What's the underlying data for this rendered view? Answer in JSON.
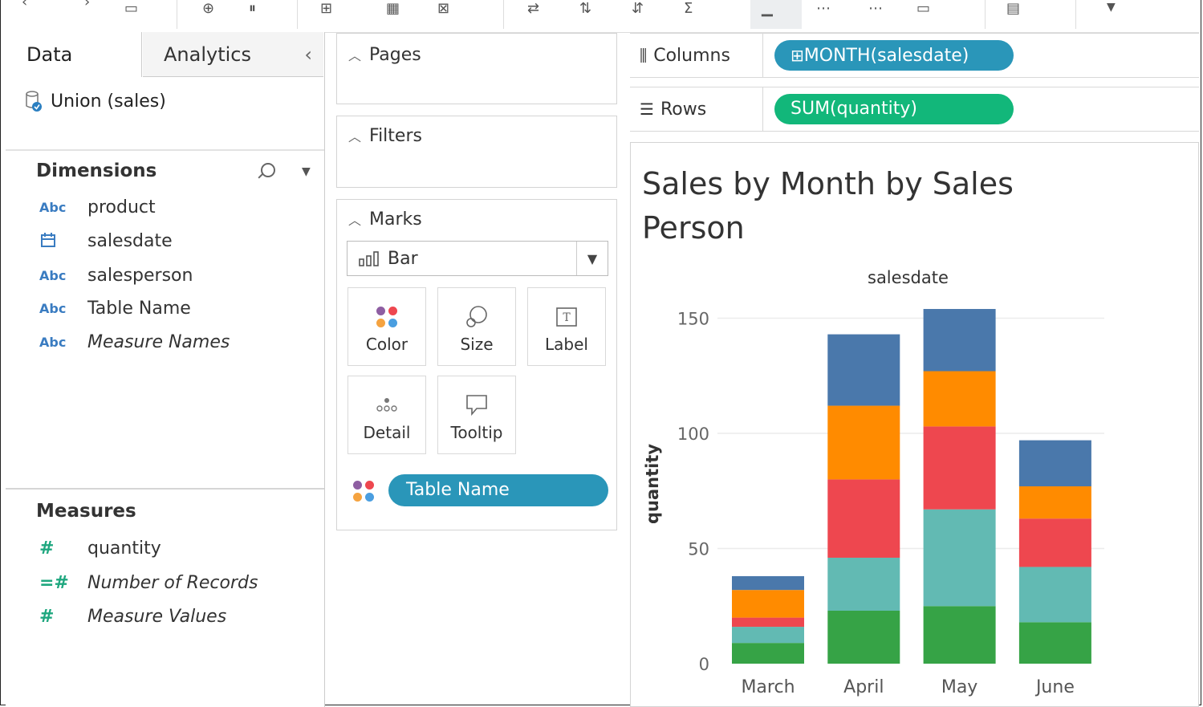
{
  "data_pane": {
    "tabs": [
      "Data",
      "Analytics"
    ],
    "datasource": "Union (sales)",
    "dimensions_label": "Dimensions",
    "dimensions": [
      {
        "type": "Abc",
        "name": "product",
        "italic": false
      },
      {
        "type": "calendar",
        "name": "salesdate",
        "italic": false
      },
      {
        "type": "Abc",
        "name": "salesperson",
        "italic": false
      },
      {
        "type": "Abc",
        "name": "Table Name",
        "italic": false
      },
      {
        "type": "Abc",
        "name": "Measure Names",
        "italic": true
      }
    ],
    "measures_label": "Measures",
    "measures": [
      {
        "type": "#",
        "name": "quantity",
        "italic": false
      },
      {
        "type": "=#",
        "name": "Number of Records",
        "italic": true
      },
      {
        "type": "#",
        "name": "Measure Values",
        "italic": true
      }
    ]
  },
  "cards": {
    "pages": "Pages",
    "filters": "Filters",
    "marks": "Marks",
    "mark_type": "Bar",
    "mark_buttons": [
      "Color",
      "Size",
      "Label",
      "Detail",
      "Tooltip"
    ],
    "color_pill": "Table Name"
  },
  "shelves": {
    "columns_label": "Columns",
    "columns_pill": "MONTH(salesdate)",
    "rows_label": "Rows",
    "rows_pill": "SUM(quantity)"
  },
  "colors": {
    "columns_pill": "#2a96b9",
    "rows_pill": "#12b77a",
    "series": [
      "#36a346",
      "#62bab3",
      "#ee474f",
      "#ff8b00",
      "#4a78ab"
    ]
  },
  "chart_data": {
    "type": "bar",
    "stacked": true,
    "title": "Sales by Month by Sales Person",
    "column_header": "salesdate",
    "xlabel": "",
    "ylabel": "quantity",
    "ylim": [
      0,
      160
    ],
    "yticks": [
      0,
      50,
      100,
      150
    ],
    "grid": true,
    "categories": [
      "March",
      "April",
      "May",
      "June"
    ],
    "series": [
      {
        "values": [
          9,
          23,
          25,
          18
        ]
      },
      {
        "values": [
          7,
          23,
          42,
          24
        ]
      },
      {
        "values": [
          4,
          34,
          36,
          21
        ]
      },
      {
        "values": [
          12,
          32,
          24,
          14
        ]
      },
      {
        "values": [
          6,
          31,
          27,
          20
        ]
      }
    ]
  }
}
